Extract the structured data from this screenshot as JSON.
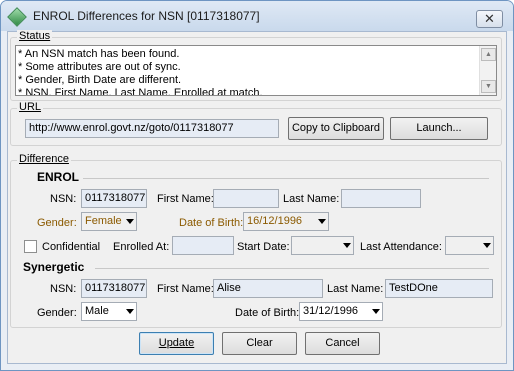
{
  "window": {
    "title": "ENROL Differences for NSN [0117318077]",
    "close_label": "✕"
  },
  "status": {
    "legend": "Status",
    "lines": [
      "* An NSN match has been found.",
      "* Some attributes are out of sync.",
      "* Gender, Birth Date are different.",
      "* NSN, First Name, Last Name, Enrolled at match."
    ]
  },
  "url": {
    "legend": "URL",
    "value": "http://www.enrol.govt.nz/goto/0117318077",
    "copy_label": "Copy to Clipboard",
    "launch_label": "Launch..."
  },
  "difference": {
    "legend": "Difference",
    "enrol": {
      "heading": "ENROL",
      "nsn_label": "NSN:",
      "nsn_value": "0117318077",
      "first_name_label": "First Name:",
      "first_name_value": "",
      "last_name_label": "Last Name:",
      "last_name_value": "",
      "gender_label": "Gender:",
      "gender_value": "Female",
      "dob_label": "Date of Birth:",
      "dob_value": "16/12/1996",
      "confidential_label": "Confidential",
      "confidential_checked": false,
      "enrolled_at_label": "Enrolled At:",
      "enrolled_at_value": "",
      "start_date_label": "Start Date:",
      "start_date_value": "",
      "last_attendance_label": "Last Attendance:",
      "last_attendance_value": ""
    },
    "synergetic": {
      "heading": "Synergetic",
      "nsn_label": "NSN:",
      "nsn_value": "0117318077",
      "first_name_label": "First Name:",
      "first_name_value": "Alise",
      "last_name_label": "Last Name:",
      "last_name_value": "TestDOne",
      "gender_label": "Gender:",
      "gender_value": "Male",
      "dob_label": "Date of Birth:",
      "dob_value": "31/12/1996"
    }
  },
  "actions": {
    "update_label": "Update",
    "clear_label": "Clear",
    "cancel_label": "Cancel"
  },
  "colors": {
    "mismatch_label": "#8b5a00",
    "title_gradient_top": "#dfe9f5",
    "field_highlight": "#e6ecf5"
  }
}
